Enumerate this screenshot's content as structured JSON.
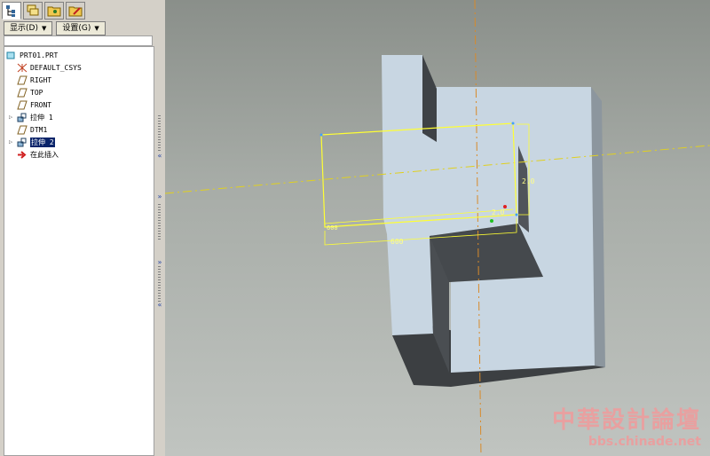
{
  "model_tree": {
    "tabs": [
      "model-tree-tab",
      "layer-tab",
      "folder-tab",
      "favorites-tab"
    ],
    "show_menu": "显示(D)",
    "settings_menu": "设置(G)",
    "items": [
      {
        "label": "PRT01.PRT",
        "icon": "part-icon"
      },
      {
        "label": "DEFAULT_CSYS",
        "icon": "csys-icon"
      },
      {
        "label": "RIGHT",
        "icon": "datum-plane-icon"
      },
      {
        "label": "TOP",
        "icon": "datum-plane-icon"
      },
      {
        "label": "FRONT",
        "icon": "datum-plane-icon"
      },
      {
        "label": "拉伸 1",
        "icon": "extrude-icon"
      },
      {
        "label": "DTM1",
        "icon": "datum-plane-icon"
      },
      {
        "label": "拉伸 2",
        "icon": "extrude-icon"
      },
      {
        "label": "在此插入",
        "icon": "insert-arrow-icon"
      }
    ]
  },
  "viewport": {
    "dimensions": [
      "600",
      "2.0",
      "2.0",
      "600"
    ],
    "colors": {
      "part": "#c8d6e2",
      "sketch": "#ffff33",
      "axis": "#d88a2a"
    }
  },
  "watermark": {
    "title": "中華設計論壇",
    "url": "bbs.chinade.net"
  }
}
